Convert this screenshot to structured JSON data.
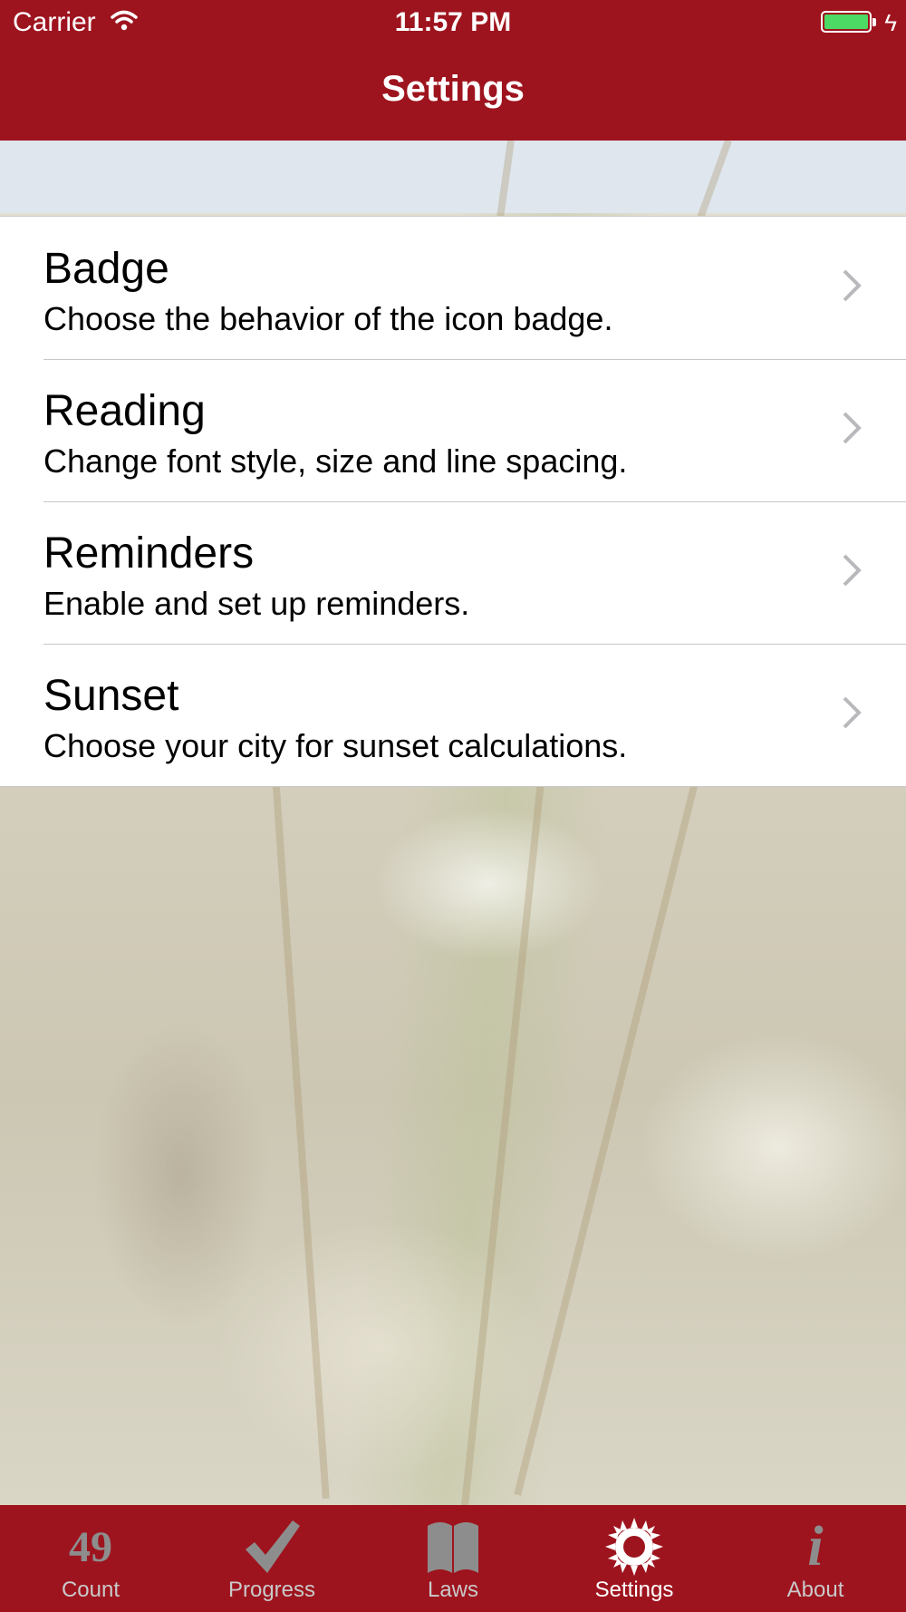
{
  "status_bar": {
    "carrier": "Carrier",
    "time": "11:57 PM",
    "battery_color": "#4cd964"
  },
  "nav": {
    "title": "Settings",
    "bar_color": "#9e141e"
  },
  "settings": {
    "items": [
      {
        "title": "Badge",
        "subtitle": "Choose the behavior of the icon badge.",
        "icon": "chevron-right-icon"
      },
      {
        "title": "Reading",
        "subtitle": "Change font style, size and line spacing.",
        "icon": "chevron-right-icon"
      },
      {
        "title": "Reminders",
        "subtitle": "Enable and set up reminders.",
        "icon": "chevron-right-icon"
      },
      {
        "title": "Sunset",
        "subtitle": "Choose your city for sunset calculations.",
        "icon": "chevron-right-icon"
      }
    ]
  },
  "tabbar": {
    "active": "Settings",
    "tabs": [
      {
        "label": "Count",
        "icon": "count-number-icon",
        "icon_text": "49"
      },
      {
        "label": "Progress",
        "icon": "checkmark-icon"
      },
      {
        "label": "Laws",
        "icon": "book-icon"
      },
      {
        "label": "Settings",
        "icon": "gear-icon"
      },
      {
        "label": "About",
        "icon": "info-icon"
      }
    ]
  }
}
